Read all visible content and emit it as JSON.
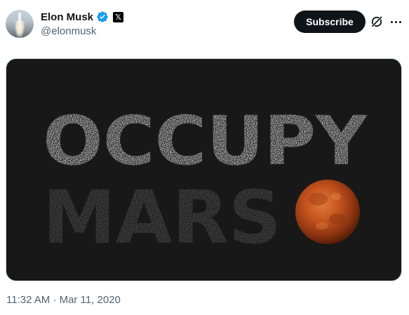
{
  "post": {
    "author": {
      "name": "Elon Musk",
      "handle": "@elonmusk",
      "verified": true,
      "affiliation_badge": "𝕏"
    },
    "actions": {
      "subscribe_label": "Subscribe"
    },
    "image": {
      "line1": "OCCUPY",
      "line2": "MARS"
    },
    "timestamp": "11:32 AM · Mar 11, 2020"
  },
  "colors": {
    "verified": "#1d9bf0",
    "image_background": "#181818",
    "line1_text": "#f2f2f2",
    "line2_text": "#5a5a5a",
    "mars": "#c2521c"
  },
  "icons": [
    "verified-badge-icon",
    "x-logo-icon",
    "grok-icon",
    "more-options-icon"
  ]
}
